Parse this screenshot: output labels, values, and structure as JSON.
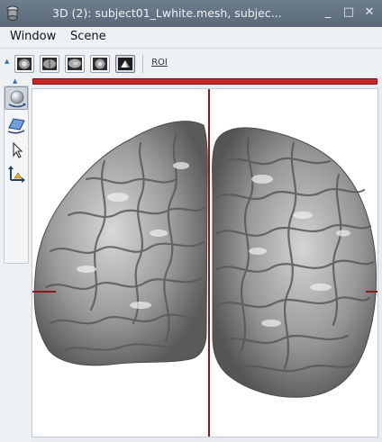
{
  "window": {
    "title": "3D (2): subject01_Lwhite.mesh, subjec...",
    "minimize_glyph": "_",
    "maximize_glyph": "□",
    "close_glyph": "✕"
  },
  "menu": {
    "items": [
      "Window",
      "Scene"
    ]
  },
  "toolbar": {
    "view_buttons": [
      {
        "icon": "axial-view-icon"
      },
      {
        "icon": "coronal-view-icon"
      },
      {
        "icon": "sagittal-view-icon"
      },
      {
        "icon": "oblique-view-icon"
      },
      {
        "icon": "3d-view-icon",
        "active": true
      }
    ],
    "roi_label": "ROI"
  },
  "tools": [
    {
      "icon": "trackball-rotate-icon",
      "active": true
    },
    {
      "icon": "flight-control-icon"
    },
    {
      "icon": "selection-arrow-icon"
    },
    {
      "icon": "axis-transform-icon"
    }
  ],
  "colors": {
    "cursor_line": "#8b1a1a",
    "indicator_bar": "#c62828",
    "mesh": "#8c8c8c",
    "background": "#ffffff"
  }
}
